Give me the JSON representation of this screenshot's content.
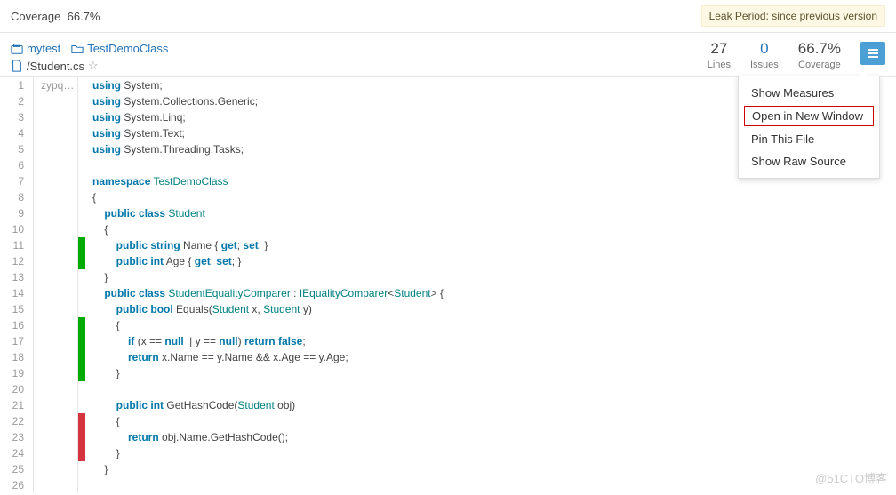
{
  "top": {
    "coverage_label": "Coverage",
    "coverage_value": "66.7%",
    "leak": "Leak Period: since previous version"
  },
  "breadcrumb": {
    "project": "mytest",
    "pkg": "TestDemoClass",
    "file": "/Student.cs"
  },
  "stats": {
    "lines_n": "27",
    "lines_l": "Lines",
    "issues_n": "0",
    "issues_l": "Issues",
    "cov_n": "66.7%",
    "cov_l": "Coverage"
  },
  "menu": {
    "show_measures": "Show Measures",
    "open_new_window": "Open in New Window",
    "pin": "Pin This File",
    "raw": "Show Raw Source"
  },
  "scm_author": "zypq…",
  "lines": [
    {
      "n": 1,
      "cov": "",
      "html": "<span class='k'>using</span> System;"
    },
    {
      "n": 2,
      "cov": "",
      "html": "<span class='k'>using</span> System.Collections.Generic;"
    },
    {
      "n": 3,
      "cov": "",
      "html": "<span class='k'>using</span> System.Linq;"
    },
    {
      "n": 4,
      "cov": "",
      "html": "<span class='k'>using</span> System.Text;"
    },
    {
      "n": 5,
      "cov": "",
      "html": "<span class='k'>using</span> System.Threading.Tasks;"
    },
    {
      "n": 6,
      "cov": "",
      "html": ""
    },
    {
      "n": 7,
      "cov": "",
      "html": "<span class='k'>namespace</span> <span class='t'>TestDemoClass</span>"
    },
    {
      "n": 8,
      "cov": "",
      "html": "{"
    },
    {
      "n": 9,
      "cov": "",
      "html": "    <span class='k'>public</span> <span class='k'>class</span> <span class='t'>Student</span>"
    },
    {
      "n": 10,
      "cov": "",
      "html": "    {"
    },
    {
      "n": 11,
      "cov": "green",
      "html": "        <span class='k'>public</span> <span class='k'>string</span> Name { <span class='k'>get</span>; <span class='k'>set</span>; }"
    },
    {
      "n": 12,
      "cov": "green",
      "html": "        <span class='k'>public</span> <span class='k'>int</span> Age { <span class='k'>get</span>; <span class='k'>set</span>; }"
    },
    {
      "n": 13,
      "cov": "",
      "html": "    }"
    },
    {
      "n": 14,
      "cov": "",
      "html": "    <span class='k'>public</span> <span class='k'>class</span> <span class='t'>StudentEqualityComparer</span> : <span class='t'>IEqualityComparer</span>&lt;<span class='t'>Student</span>&gt; {"
    },
    {
      "n": 15,
      "cov": "",
      "html": "        <span class='k'>public</span> <span class='k'>bool</span> Equals(<span class='t'>Student</span> x, <span class='t'>Student</span> y)"
    },
    {
      "n": 16,
      "cov": "green",
      "html": "        {"
    },
    {
      "n": 17,
      "cov": "green",
      "html": "            <span class='k'>if</span> (x == <span class='k'>null</span> || y == <span class='k'>null</span>) <span class='k'>return</span> <span class='k'>false</span>;"
    },
    {
      "n": 18,
      "cov": "green",
      "html": "            <span class='k'>return</span> x.Name == y.Name &amp;&amp; x.Age == y.Age;"
    },
    {
      "n": 19,
      "cov": "green",
      "html": "        }"
    },
    {
      "n": 20,
      "cov": "",
      "html": ""
    },
    {
      "n": 21,
      "cov": "",
      "html": "        <span class='k'>public</span> <span class='k'>int</span> GetHashCode(<span class='t'>Student</span> obj)"
    },
    {
      "n": 22,
      "cov": "red",
      "html": "        {"
    },
    {
      "n": 23,
      "cov": "red",
      "html": "            <span class='k'>return</span> obj.Name.GetHashCode();"
    },
    {
      "n": 24,
      "cov": "red",
      "html": "        }"
    },
    {
      "n": 25,
      "cov": "",
      "html": "    }"
    },
    {
      "n": 26,
      "cov": "",
      "html": ""
    }
  ],
  "watermark": "@51CTO博客"
}
